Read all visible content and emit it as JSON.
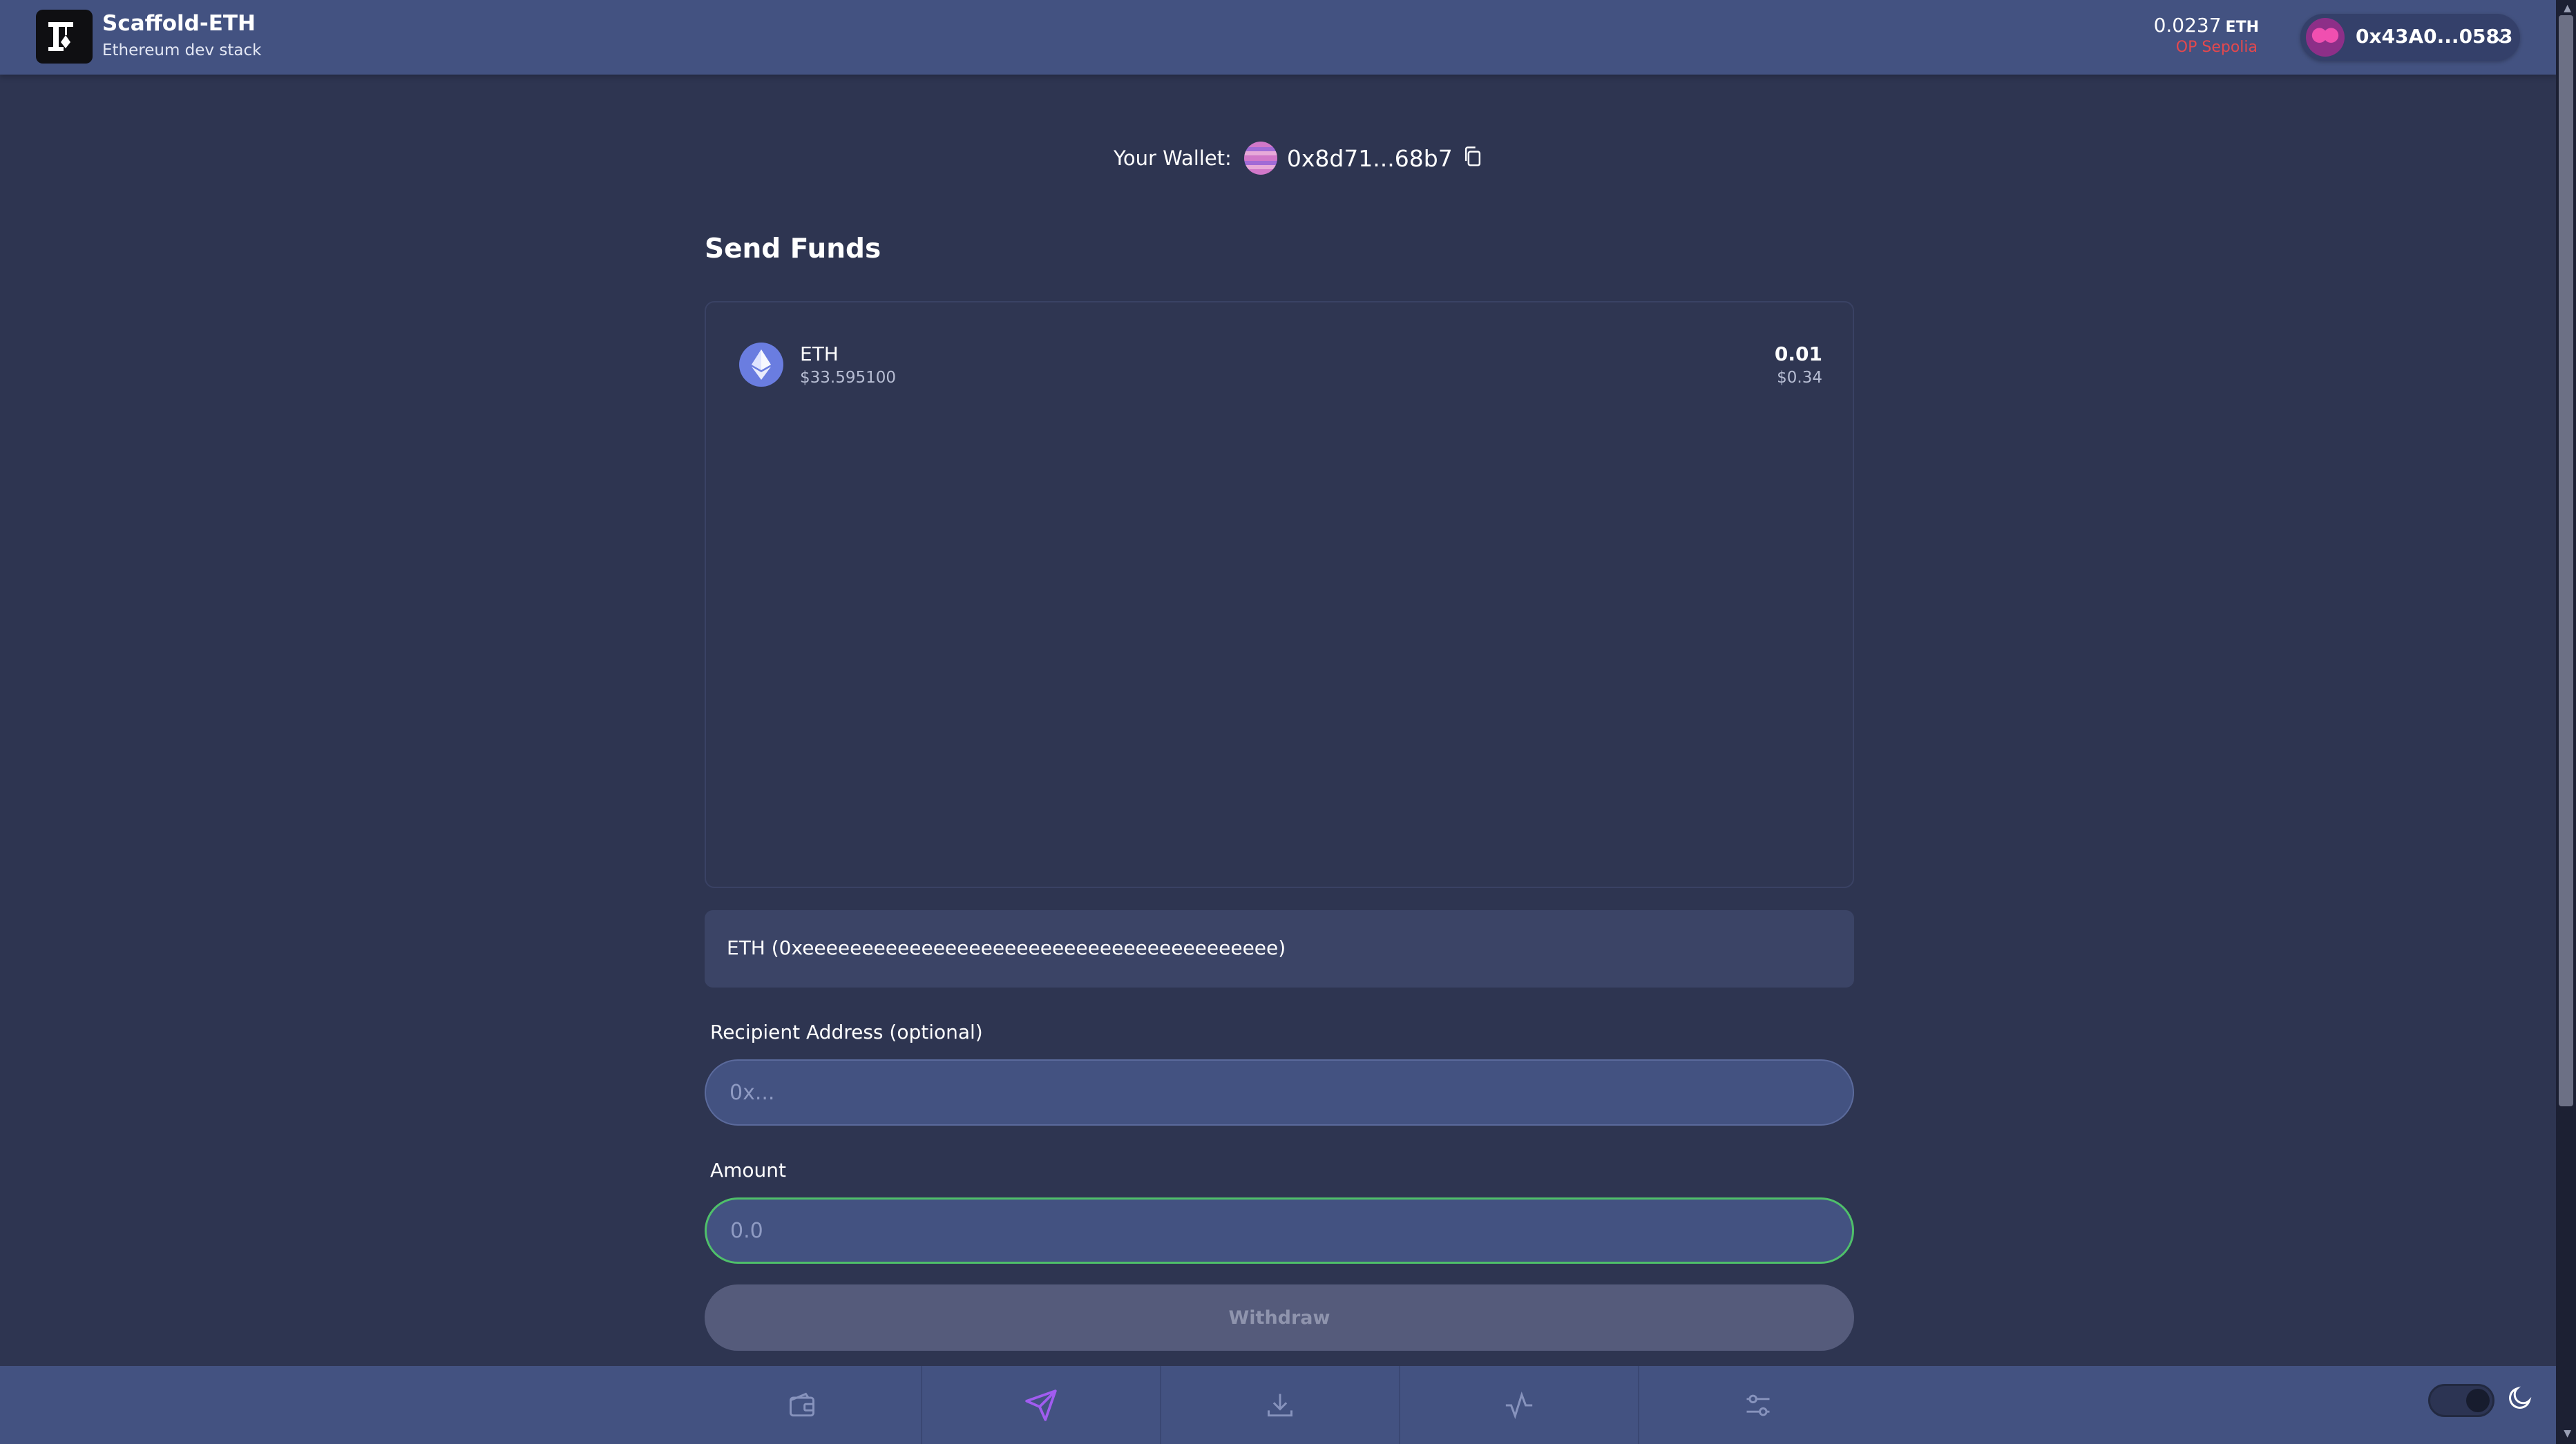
{
  "header": {
    "title": "Scaffold-ETH",
    "subtitle": "Ethereum dev stack",
    "balance": "0.0237",
    "balance_unit": "ETH",
    "network": "OP Sepolia",
    "account_address": "0x43A0...0583"
  },
  "wallet": {
    "label": "Your Wallet:",
    "address": "0x8d71...68b7"
  },
  "send": {
    "title": "Send Funds",
    "tokens": [
      {
        "symbol": "ETH",
        "price": "$33.595100",
        "balance": "0.01",
        "value_usd": "$0.34",
        "icon": "ethereum-icon"
      }
    ],
    "selected_token": "ETH (0xeeeeeeeeeeeeeeeeeeeeeeeeeeeeeeeeeeeeeeee)",
    "recipient_label": "Recipient Address (optional)",
    "recipient_placeholder": "0x...",
    "amount_label": "Amount",
    "amount_placeholder": "0.0",
    "withdraw_label": "Withdraw"
  },
  "nav": {
    "items": [
      {
        "icon": "wallet-icon",
        "active": false
      },
      {
        "icon": "send-icon",
        "active": true
      },
      {
        "icon": "download-icon",
        "active": false
      },
      {
        "icon": "activity-icon",
        "active": false
      },
      {
        "icon": "settings-sliders-icon",
        "active": false
      }
    ]
  },
  "theme": {
    "mode": "dark",
    "icon": "moon-icon"
  },
  "colors": {
    "background": "#2e3551",
    "header": "#435281",
    "accent": "#a15cf0",
    "network": "#e5484d",
    "amount_border": "#4fc06a"
  }
}
